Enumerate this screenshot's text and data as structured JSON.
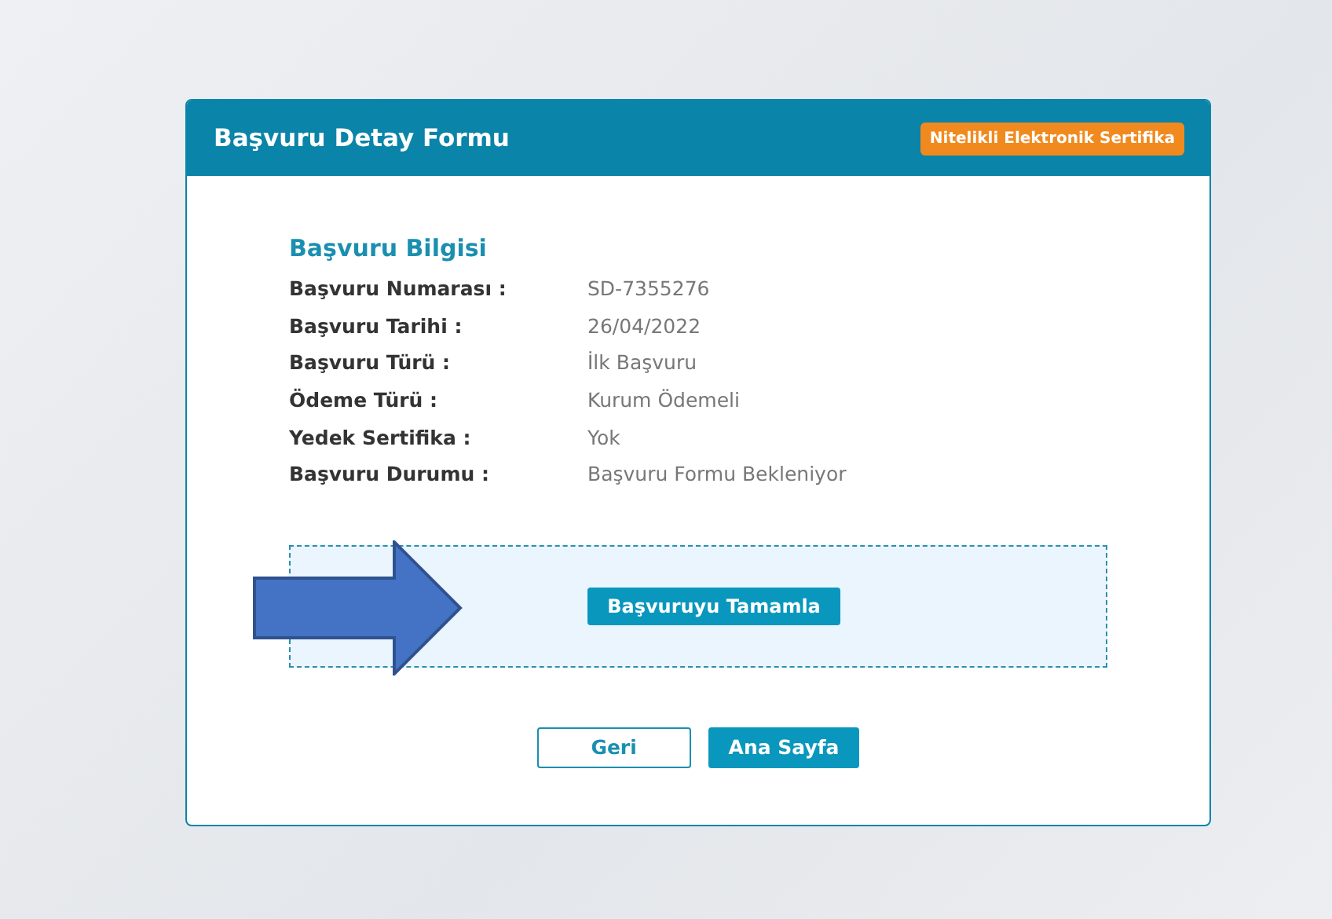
{
  "window": {
    "title": "Başvuru Detay Formu",
    "badge": "Nitelikli Elektronik Sertifika"
  },
  "section": {
    "title": "Başvuru Bilgisi",
    "rows": [
      {
        "label": "Başvuru Numarası :",
        "value": "SD-7355276"
      },
      {
        "label": "Başvuru Tarihi :",
        "value": "26/04/2022"
      },
      {
        "label": "Başvuru Türü :",
        "value": "İlk Başvuru"
      },
      {
        "label": "Ödeme Türü :",
        "value": "Kurum Ödemeli"
      },
      {
        "label": "Yedek Sertifika :",
        "value": "Yok"
      },
      {
        "label": "Başvuru Durumu :",
        "value": "Başvuru Formu Bekleniyor"
      }
    ]
  },
  "action": {
    "label": "Başvuruyu Tamamla"
  },
  "buttons": [
    {
      "label": "Geri",
      "kind": "outline"
    },
    {
      "label": "Ana Sayfa",
      "kind": "primary"
    }
  ]
}
